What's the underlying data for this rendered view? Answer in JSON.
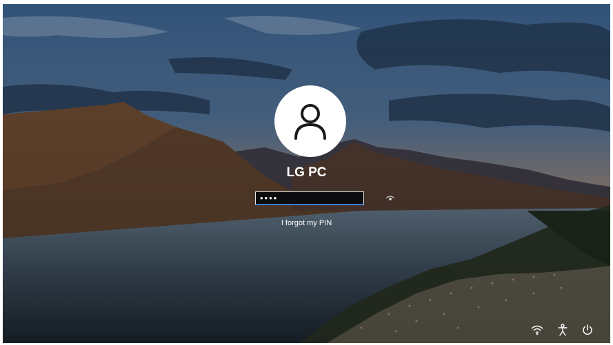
{
  "user": {
    "name": "LG PC",
    "avatar_icon": "person-icon"
  },
  "pin": {
    "value": "••••",
    "reveal_icon": "eye-icon"
  },
  "links": {
    "forgot_pin": "I forgot my PIN"
  },
  "tray": {
    "network_icon": "wifi-icon",
    "accessibility_icon": "accessibility-icon",
    "power_icon": "power-icon"
  },
  "colors": {
    "accent": "#3a7bd5",
    "text": "#ffffff"
  }
}
